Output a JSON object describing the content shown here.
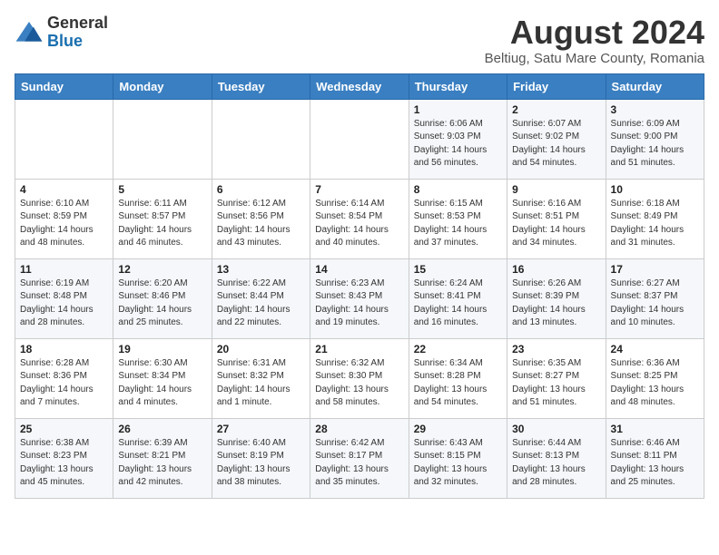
{
  "header": {
    "logo_general": "General",
    "logo_blue": "Blue",
    "month_title": "August 2024",
    "subtitle": "Beltiug, Satu Mare County, Romania"
  },
  "days_of_week": [
    "Sunday",
    "Monday",
    "Tuesday",
    "Wednesday",
    "Thursday",
    "Friday",
    "Saturday"
  ],
  "weeks": [
    [
      {
        "day": "",
        "info": ""
      },
      {
        "day": "",
        "info": ""
      },
      {
        "day": "",
        "info": ""
      },
      {
        "day": "",
        "info": ""
      },
      {
        "day": "1",
        "info": "Sunrise: 6:06 AM\nSunset: 9:03 PM\nDaylight: 14 hours\nand 56 minutes."
      },
      {
        "day": "2",
        "info": "Sunrise: 6:07 AM\nSunset: 9:02 PM\nDaylight: 14 hours\nand 54 minutes."
      },
      {
        "day": "3",
        "info": "Sunrise: 6:09 AM\nSunset: 9:00 PM\nDaylight: 14 hours\nand 51 minutes."
      }
    ],
    [
      {
        "day": "4",
        "info": "Sunrise: 6:10 AM\nSunset: 8:59 PM\nDaylight: 14 hours\nand 48 minutes."
      },
      {
        "day": "5",
        "info": "Sunrise: 6:11 AM\nSunset: 8:57 PM\nDaylight: 14 hours\nand 46 minutes."
      },
      {
        "day": "6",
        "info": "Sunrise: 6:12 AM\nSunset: 8:56 PM\nDaylight: 14 hours\nand 43 minutes."
      },
      {
        "day": "7",
        "info": "Sunrise: 6:14 AM\nSunset: 8:54 PM\nDaylight: 14 hours\nand 40 minutes."
      },
      {
        "day": "8",
        "info": "Sunrise: 6:15 AM\nSunset: 8:53 PM\nDaylight: 14 hours\nand 37 minutes."
      },
      {
        "day": "9",
        "info": "Sunrise: 6:16 AM\nSunset: 8:51 PM\nDaylight: 14 hours\nand 34 minutes."
      },
      {
        "day": "10",
        "info": "Sunrise: 6:18 AM\nSunset: 8:49 PM\nDaylight: 14 hours\nand 31 minutes."
      }
    ],
    [
      {
        "day": "11",
        "info": "Sunrise: 6:19 AM\nSunset: 8:48 PM\nDaylight: 14 hours\nand 28 minutes."
      },
      {
        "day": "12",
        "info": "Sunrise: 6:20 AM\nSunset: 8:46 PM\nDaylight: 14 hours\nand 25 minutes."
      },
      {
        "day": "13",
        "info": "Sunrise: 6:22 AM\nSunset: 8:44 PM\nDaylight: 14 hours\nand 22 minutes."
      },
      {
        "day": "14",
        "info": "Sunrise: 6:23 AM\nSunset: 8:43 PM\nDaylight: 14 hours\nand 19 minutes."
      },
      {
        "day": "15",
        "info": "Sunrise: 6:24 AM\nSunset: 8:41 PM\nDaylight: 14 hours\nand 16 minutes."
      },
      {
        "day": "16",
        "info": "Sunrise: 6:26 AM\nSunset: 8:39 PM\nDaylight: 14 hours\nand 13 minutes."
      },
      {
        "day": "17",
        "info": "Sunrise: 6:27 AM\nSunset: 8:37 PM\nDaylight: 14 hours\nand 10 minutes."
      }
    ],
    [
      {
        "day": "18",
        "info": "Sunrise: 6:28 AM\nSunset: 8:36 PM\nDaylight: 14 hours\nand 7 minutes."
      },
      {
        "day": "19",
        "info": "Sunrise: 6:30 AM\nSunset: 8:34 PM\nDaylight: 14 hours\nand 4 minutes."
      },
      {
        "day": "20",
        "info": "Sunrise: 6:31 AM\nSunset: 8:32 PM\nDaylight: 14 hours\nand 1 minute."
      },
      {
        "day": "21",
        "info": "Sunrise: 6:32 AM\nSunset: 8:30 PM\nDaylight: 13 hours\nand 58 minutes."
      },
      {
        "day": "22",
        "info": "Sunrise: 6:34 AM\nSunset: 8:28 PM\nDaylight: 13 hours\nand 54 minutes."
      },
      {
        "day": "23",
        "info": "Sunrise: 6:35 AM\nSunset: 8:27 PM\nDaylight: 13 hours\nand 51 minutes."
      },
      {
        "day": "24",
        "info": "Sunrise: 6:36 AM\nSunset: 8:25 PM\nDaylight: 13 hours\nand 48 minutes."
      }
    ],
    [
      {
        "day": "25",
        "info": "Sunrise: 6:38 AM\nSunset: 8:23 PM\nDaylight: 13 hours\nand 45 minutes."
      },
      {
        "day": "26",
        "info": "Sunrise: 6:39 AM\nSunset: 8:21 PM\nDaylight: 13 hours\nand 42 minutes."
      },
      {
        "day": "27",
        "info": "Sunrise: 6:40 AM\nSunset: 8:19 PM\nDaylight: 13 hours\nand 38 minutes."
      },
      {
        "day": "28",
        "info": "Sunrise: 6:42 AM\nSunset: 8:17 PM\nDaylight: 13 hours\nand 35 minutes."
      },
      {
        "day": "29",
        "info": "Sunrise: 6:43 AM\nSunset: 8:15 PM\nDaylight: 13 hours\nand 32 minutes."
      },
      {
        "day": "30",
        "info": "Sunrise: 6:44 AM\nSunset: 8:13 PM\nDaylight: 13 hours\nand 28 minutes."
      },
      {
        "day": "31",
        "info": "Sunrise: 6:46 AM\nSunset: 8:11 PM\nDaylight: 13 hours\nand 25 minutes."
      }
    ]
  ]
}
